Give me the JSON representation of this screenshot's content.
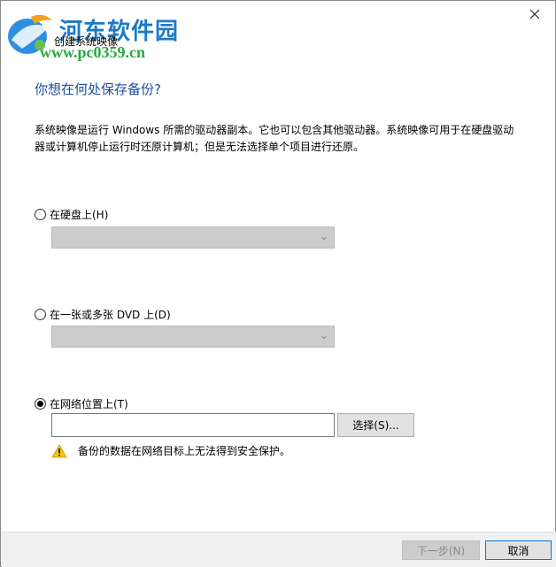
{
  "watermark": {
    "title": "河东软件园",
    "url": "www.pc0359.cn"
  },
  "window": {
    "title": "创建系统映像",
    "close_icon": "close-icon"
  },
  "heading": "你想在何处保存备份?",
  "description": "系统映像是运行 Windows 所需的驱动器副本。它也可以包含其他驱动器。系统映像可用于在硬盘驱动器或计算机停止运行时还原计算机；但是无法选择单个项目进行还原。",
  "options": {
    "hard_disk": {
      "label": "在硬盘上(H)",
      "selected": false,
      "value": ""
    },
    "dvd": {
      "label": "在一张或多张 DVD 上(D)",
      "selected": false,
      "value": ""
    },
    "network": {
      "label": "在网络位置上(T)",
      "selected": true,
      "value": ""
    }
  },
  "browse_button": "选择(S)...",
  "warning": {
    "icon": "warning-icon",
    "text": "备份的数据在网络目标上无法得到安全保护。"
  },
  "footer": {
    "next_label": "下一步(N)",
    "cancel_label": "取消"
  },
  "colors": {
    "heading": "#1b4ea0",
    "watermark_title": "#1c79c9",
    "watermark_url": "#2aa83b",
    "disabled_select": "#cccccc",
    "focus_border": "#0078d7"
  }
}
